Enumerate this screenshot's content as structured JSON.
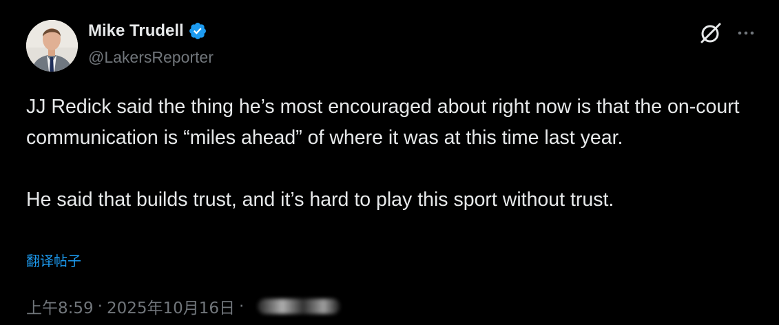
{
  "author": {
    "name": "Mike Trudell",
    "handle": "@LakersReporter",
    "avatar_icon": "profile-photo",
    "verified_icon": "verified-badge-icon"
  },
  "post": {
    "paragraphs": [
      "JJ Redick said the thing he’s most encouraged about right now is that the on-court communication is “miles ahead” of where it was at this time last year.",
      "He said that builds trust, and it’s hard to play this sport without trust."
    ],
    "translate_link": "翻译帖子",
    "time": "上午8:59",
    "separator": "·",
    "date": "2025年10月16日",
    "separator2": "·"
  },
  "toolbar": {
    "grok_icon": "grok-icon",
    "more_icon": "more-icon"
  },
  "colors": {
    "background": "#000000",
    "text": "#e7e9ea",
    "muted": "#71767b",
    "link": "#1d9bf0",
    "verified": "#1d9bf0"
  }
}
